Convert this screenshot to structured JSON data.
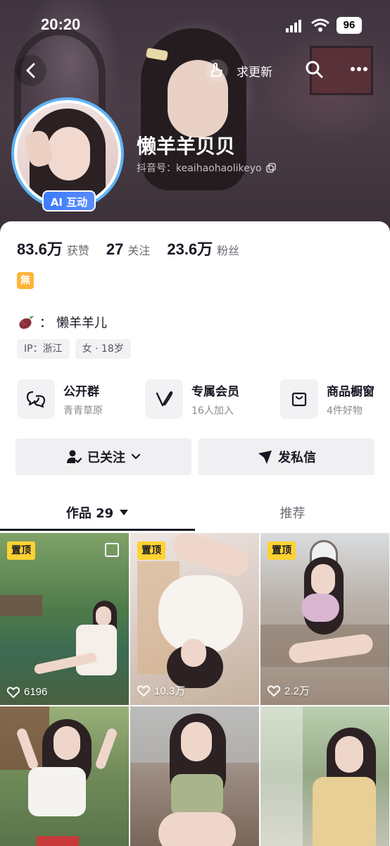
{
  "status_bar": {
    "time": "20:20",
    "battery": "96"
  },
  "header": {
    "update_label": "求更新",
    "nickname": "懒羊羊贝贝",
    "douyin_id": "抖音号：keaihaohaolikeyo",
    "ai_badge": "AI 互动"
  },
  "stats": [
    {
      "value": "83.6万",
      "label": "获赞"
    },
    {
      "value": "27",
      "label": "关注"
    },
    {
      "value": "23.6万",
      "label": "粉丝"
    }
  ],
  "tag_icon": "無",
  "bio": {
    "prefix": "：",
    "text": "懒羊羊儿"
  },
  "chips": [
    "IP：浙江",
    "女 · 18岁"
  ],
  "features": [
    {
      "title": "公开群",
      "sub": "青青草原",
      "icon": "chat-group-icon"
    },
    {
      "title": "专属会员",
      "sub": "16人加入",
      "icon": "membership-v-icon"
    },
    {
      "title": "商品橱窗",
      "sub": "4件好物",
      "icon": "shopping-bag-icon"
    }
  ],
  "actions": {
    "follow": "已关注",
    "message": "发私信"
  },
  "tabs": {
    "works": "作品 29",
    "recommend": "推荐"
  },
  "tiles": [
    {
      "pinned": "置顶",
      "likes": "6196",
      "multi": true
    },
    {
      "pinned": "置顶",
      "likes": "10.3万",
      "multi": false
    },
    {
      "pinned": "置顶",
      "likes": "2.2万",
      "multi": false
    },
    {
      "pinned": "",
      "likes": "",
      "multi": false
    },
    {
      "pinned": "",
      "likes": "",
      "multi": false
    },
    {
      "pinned": "",
      "likes": "",
      "multi": false
    }
  ],
  "colors": {
    "avatar_ring": "#5fb3f5",
    "ai_badge": "#3d7bff",
    "pin_badge": "#ffd233"
  }
}
